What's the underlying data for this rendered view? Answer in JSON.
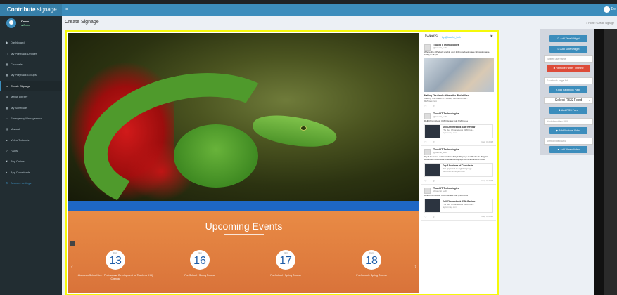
{
  "topbar": {
    "brand_bold": "Contribute",
    "brand_light": " signage",
    "menu_icon": "hamburger-icon",
    "user_initial": "De"
  },
  "profile": {
    "name": "Demo",
    "status": "● Online"
  },
  "sidebar": {
    "items": [
      {
        "label": "Dashboard",
        "icon": "dashboard-icon",
        "glyph": "◆"
      },
      {
        "label": "My Playback Devices",
        "icon": "device-icon",
        "glyph": "▢"
      },
      {
        "label": "Channels",
        "icon": "channels-icon",
        "glyph": "▦"
      },
      {
        "label": "My Playback Groups",
        "icon": "groups-icon",
        "glyph": "▦"
      },
      {
        "label": "Create Signage",
        "icon": "signage-icon",
        "glyph": "▭"
      },
      {
        "label": "Media Library",
        "icon": "media-icon",
        "glyph": "▤"
      },
      {
        "label": "My Schedule",
        "icon": "schedule-icon",
        "glyph": "▦"
      },
      {
        "label": "Emergency Management",
        "icon": "emergency-icon",
        "glyph": "○"
      },
      {
        "label": "Manual",
        "icon": "manual-icon",
        "glyph": "▤"
      },
      {
        "label": "Video Tutorials",
        "icon": "video-icon",
        "glyph": "▶"
      },
      {
        "label": "FAQs",
        "icon": "faq-icon",
        "glyph": "?"
      },
      {
        "label": "Buy Online",
        "icon": "cart-icon",
        "glyph": "▼"
      },
      {
        "label": "App Downloads",
        "icon": "download-icon",
        "glyph": "▲"
      },
      {
        "label": "Account settings",
        "icon": "settings-icon",
        "glyph": "⚙"
      }
    ]
  },
  "page": {
    "title": "Create Signage",
    "breadcrumb": "⌂ Home  ›  Create Signage"
  },
  "events": {
    "title": "Upcoming Events",
    "items": [
      {
        "month": "DEC",
        "day": "13",
        "caption": "Aberdeen School Dev - Professional Development for Teachers (HD) Chennai"
      },
      {
        "month": "DEC",
        "day": "16",
        "caption": "Pre-School - Spring Recess"
      },
      {
        "month": "DEC",
        "day": "17",
        "caption": "Pre-School - Spring Recess"
      },
      {
        "month": "DEC",
        "day": "18",
        "caption": "Pre-School - Spring Recess"
      }
    ]
  },
  "tweets": {
    "title": "Tweets",
    "by": "by @touchit_tech",
    "items": [
      {
        "author": "TouchIT Technologies",
        "handle": "@touchit_tech",
        "text": "Where the #iPad will enable your #Chromebook stage.Show of phase. buff.ly/Ku8cpR",
        "link_title": "Making The Grade: Where the iPad still sc...",
        "link_desc": "Making The Grade is a weekly series from M...",
        "link_site": "9to5mac.com",
        "has_image": true,
        "date": ""
      },
      {
        "author": "TouchIT Technologies",
        "handle": "@touchit_tech",
        "text": "Dell Chromebook 3180 Review buff.ly/2lD4oLe",
        "card_title": "Dell Chromebook 3180 Review",
        "card_sub": "The Dell Chromebook 3180 has...",
        "card_site": "laptopmag.com",
        "date": "May 3, 2018"
      },
      {
        "author": "TouchIT Technologies",
        "handle": "@touchit_tech",
        "text": "Top 3 Features of #Contribute #DigitalSignage for #Schools #Digital #education #software #interactivedisplays #smartboard #schools",
        "card_title": "Top 3 Features of Contribute ...",
        "card_sub": "Our approach to digital signage ...",
        "card_site": "touchittechnologies.com",
        "date": "May 3, 2018"
      },
      {
        "author": "TouchIT Technologies",
        "handle": "@touchit_tech",
        "text": "Dell Chromebook 3180 Review buff.ly/2lD4oLe",
        "card_title": "Dell Chromebook 3180 Review",
        "card_sub": "The Dell Chromebook 3180 has...",
        "card_site": "laptopmag.com",
        "date": "May 3, 2018"
      }
    ]
  },
  "widgets": {
    "add_time_widget": "⊡ Add Time Widget",
    "add_date_widget": "⊡ Add Date Widget",
    "twitter_placeholder": "Twitter username",
    "remove_twitter": "✖ Remove Twitter Timeline",
    "facebook_placeholder": "Facebook page link",
    "add_facebook": "f Add Facebook Page",
    "rss_select": "Select RSS Feed",
    "add_rss": "✚ Add RSS Feed",
    "youtube_placeholder": "Youtube video URL",
    "add_youtube": "▶ Add Youtube Video",
    "vimeo_placeholder": "Vimeo video URL",
    "add_vimeo": "▼ Add Vimeo Video"
  },
  "colors": {
    "accent": "#3c8dbc",
    "sidebar": "#222d32",
    "danger": "#dd4b39",
    "selection_border": "#f5f90a",
    "events_bg": "#e07d3f"
  }
}
